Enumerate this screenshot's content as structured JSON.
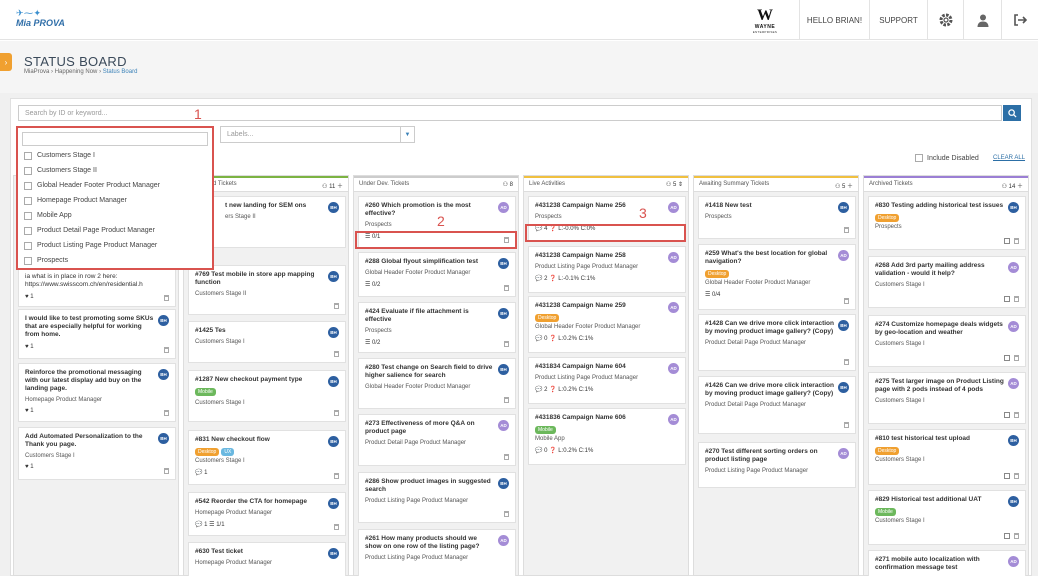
{
  "topbar": {
    "logo_birds": "✈ ⁓ ✦",
    "logo_text": "Mia PROVA",
    "wayne": {
      "mark": "W",
      "name": "WAYNE",
      "sub": "ENTERPRISES"
    },
    "greeting": "HELLO BRIAN!",
    "support": "SUPPORT",
    "icons": [
      "gear-icon",
      "user-icon",
      "logout-icon"
    ]
  },
  "header": {
    "title": "STATUS BOARD",
    "breadcrumb": [
      "MiaProva",
      "Happening Now",
      "Status Board"
    ],
    "sep": "›"
  },
  "filters": {
    "search_placeholder": "Search by ID or keyword...",
    "labels_placeholder": "Labels...",
    "include_disabled": "Include Disabled",
    "clear_all": "CLEAR ALL",
    "dropdown_options": [
      "Customers Stage I",
      "Customers Stage II",
      "Global Header Footer Product Manager",
      "Homepage Product Manager",
      "Mobile App",
      "Product Detail Page Product Manager",
      "Product Listing Page Product Manager",
      "Prospects"
    ]
  },
  "annotations": [
    "1",
    "2",
    "3"
  ],
  "columns": [
    {
      "title": "",
      "count": "",
      "cards": [
        {
          "title": "ia what is in place in row 2 here: https://www.swisscom.ch/en/residential.h",
          "sub": "",
          "meta": "♥ 1"
        },
        {
          "title": "I would like to test promoting some SKUs that are especially helpful for working from home.",
          "avatar": "BH",
          "sub": "",
          "meta": "♥ 1"
        },
        {
          "title": "Reinforce the promotional messaging with our latest display add buy on the landing page.",
          "avatar": "BH",
          "sub": "Homepage Product Manager",
          "meta": "♥ 1"
        },
        {
          "title": "Add Automated Personalization to the Thank you page.",
          "avatar": "BH",
          "sub": "Customers Stage I",
          "meta": "♥ 1"
        }
      ]
    },
    {
      "title": "d Tickets",
      "count": "11",
      "cards": [
        {
          "title": "t new landing for SEM ons",
          "avatar": "BH",
          "sub": "ers Stage II"
        },
        {
          "title": "#769 Test mobile in store app mapping function",
          "avatar": "BH",
          "sub": "Customers Stage II"
        },
        {
          "title": "#1425 Tes",
          "avatar": "BH",
          "sub": "Customers Stage I"
        },
        {
          "title": "#1287 New checkout payment type",
          "avatar": "BH",
          "pills": [
            "Mobile"
          ],
          "sub": "Customers Stage I"
        },
        {
          "title": "#831 New checkout flow",
          "avatar": "BH",
          "pills": [
            "Desktop",
            "UX"
          ],
          "sub": "Customers Stage I",
          "meta": "💬 1"
        },
        {
          "title": "#542 Reorder the CTA for homepage",
          "avatar": "BH",
          "sub": "Homepage Product Manager",
          "meta": "💬 1   ☰ 1/1"
        },
        {
          "title": "#630 Test ticket",
          "avatar": "BH",
          "sub": "Homepage Product Manager"
        }
      ]
    },
    {
      "title": "Under Dev. Tickets",
      "count": "8",
      "cards": [
        {
          "title": "#260 Which promotion is the most effective?",
          "avatar": "AD",
          "sub": "Prospects",
          "meta": "☰ 0/1"
        },
        {
          "title": "#288 Global flyout simplification test",
          "avatar": "BH",
          "sub": "Global Header Footer Product Manager",
          "meta": "☰ 0/2"
        },
        {
          "title": "#424 Evaluate if file attachment is effective",
          "avatar": "BH",
          "sub": "Prospects",
          "meta": "☰ 0/2"
        },
        {
          "title": "#280 Test change on Search field to drive higher salience for search",
          "avatar": "BH",
          "sub": "Global Header Footer Product Manager"
        },
        {
          "title": "#273 Effectiveness of more Q&A on product page",
          "avatar": "AD",
          "sub": "Product Detail Page Product Manager"
        },
        {
          "title": "#286 Show product images in suggested search",
          "avatar": "BH",
          "sub": "Product Listing Page Product Manager"
        },
        {
          "title": "#261 How many products should we show on one row of the listing page?",
          "avatar": "AD",
          "sub": "Product Listing Page Product Manager"
        }
      ]
    },
    {
      "title": "Live Activities",
      "count": "5",
      "cards": [
        {
          "title": "#431238 Campaign Name 256",
          "avatar": "AD",
          "sub": "Prospects",
          "meta": "💬 4   ❓ L:-0.0% C:0%"
        },
        {
          "title": "#431238 Campaign Name 258",
          "avatar": "AD",
          "sub": "Product Listing Page Product Manager",
          "meta": "💬 2   ❓ L:-0.1% C:1%"
        },
        {
          "title": "#431238 Campaign Name 259",
          "avatar": "AD",
          "pills": [
            "Desktop"
          ],
          "sub": "Global Header Footer Product Manager",
          "meta": "💬 0   ❓ L:0.2% C:1%"
        },
        {
          "title": "#431834 Campaign Name 604",
          "avatar": "AD",
          "sub": "Product Listing Page Product Manager",
          "meta": "💬 2   ❓ L:0.2% C:1%"
        },
        {
          "title": "#431836 Campaign Name 606",
          "avatar": "AD",
          "pills": [
            "Mobile"
          ],
          "sub": "Mobile App",
          "meta": "💬 0   ❓ L:0.2% C:1%"
        }
      ]
    },
    {
      "title": "Awaiting Summary Tickets",
      "count": "5",
      "cards": [
        {
          "title": "#1418 New test",
          "avatar": "BH",
          "sub": "Prospects"
        },
        {
          "title": "#259 What's the best location for global navigation?",
          "avatar": "AD",
          "pills": [
            "Desktop"
          ],
          "sub": "Global Header Footer Product Manager",
          "meta": "☰ 0/4"
        },
        {
          "title": "#1428 Can we drive more click interaction by moving product image gallery? (Copy)",
          "avatar": "BH",
          "sub": "Product Detail Page Product Manager"
        },
        {
          "title": "#1426 Can we drive more click interaction by moving product image gallery? (Copy)",
          "avatar": "BH",
          "sub": "Product Detail Page Product Manager"
        },
        {
          "title": "#270 Test different sorting orders on product listing page",
          "avatar": "AD",
          "sub": "Product Listing Page Product Manager"
        }
      ]
    },
    {
      "title": "Archived Tickets",
      "count": "14",
      "cards": [
        {
          "title": "#830 Testing adding historical test issues",
          "avatar": "BH",
          "pills": [
            "Desktop"
          ],
          "sub": "Prospects"
        },
        {
          "title": "#268 Add 3rd party mailing address validation - would it help?",
          "avatar": "AD",
          "sub": "Customers Stage I"
        },
        {
          "title": "#274 Customize homepage deals widgets by geo-location and weather",
          "avatar": "AD",
          "sub": "Customers Stage I"
        },
        {
          "title": "#275 Test larger image on Product Listing page with 2 pods instead of 4 pods",
          "avatar": "AD",
          "sub": "Customers Stage I"
        },
        {
          "title": "#810 test historical test upload",
          "avatar": "BH",
          "pills": [
            "Desktop"
          ],
          "sub": "Customers Stage I"
        },
        {
          "title": "#829 Historical test additional UAT",
          "avatar": "BH",
          "pills": [
            "Mobile"
          ],
          "sub": "Customers Stage I"
        },
        {
          "title": "#271 mobile auto localization with confirmation message test",
          "avatar": "AD",
          "sub": ""
        }
      ]
    }
  ],
  "colors": {
    "accent": "#2c6fa6",
    "annotation_red": "#d9534f",
    "desktop_pill": "#f0a030",
    "mobile_pill": "#6cb85c",
    "ux_pill": "#6ab8e0",
    "avatar_bh": "#2d5fa0",
    "avatar_ad": "#a48cd6"
  }
}
